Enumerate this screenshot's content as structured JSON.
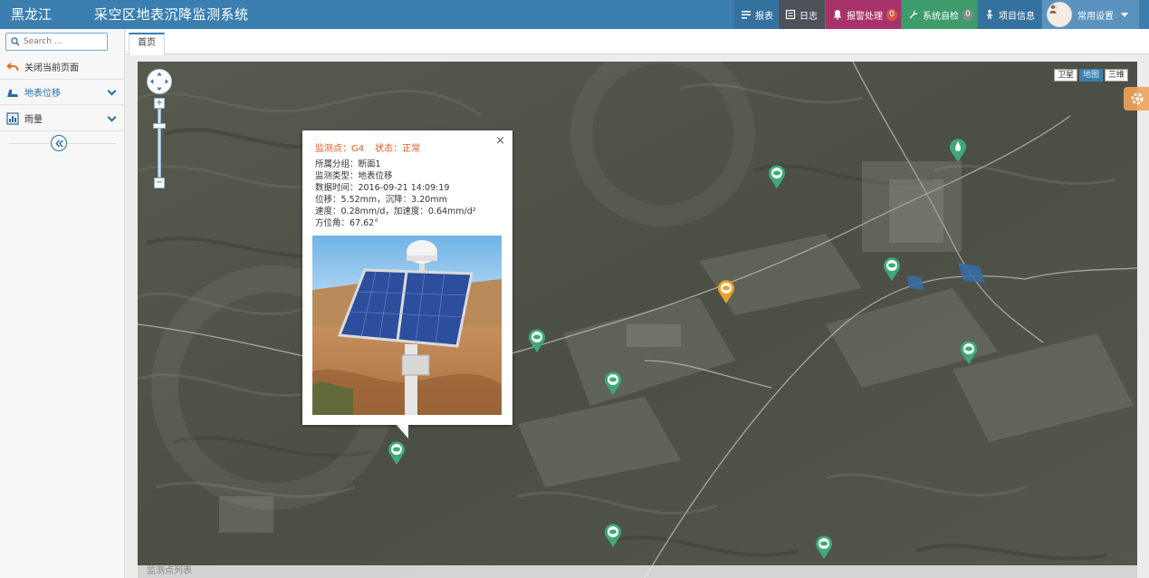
{
  "header": {
    "brand": "黑龙江",
    "title": "采空区地表沉降监测系统",
    "buttons": {
      "report": "报表",
      "log": "日志",
      "alarm": "报警处理",
      "alarm_count": "0",
      "selfcheck": "系统自检",
      "selfcheck_count": "0",
      "project": "项目信息",
      "settings": "常用设置"
    },
    "colors": {
      "bar": "#3a7fb0",
      "alarm": "#a8336a",
      "selfcheck": "#3e9b6c"
    }
  },
  "sidebar": {
    "search_placeholder": "Search ...",
    "items": [
      {
        "label": "关闭当前页面",
        "icon": "undo-icon"
      },
      {
        "label": "地表位移",
        "icon": "displacement-icon"
      },
      {
        "label": "雨量",
        "icon": "rain-gauge-icon"
      }
    ]
  },
  "tabs": [
    {
      "label": "首页"
    }
  ],
  "map": {
    "types": [
      "卫星",
      "地图",
      "三维"
    ],
    "active_type": "地图",
    "bottom_text": "监测点列表"
  },
  "popup": {
    "point_label": "监测点：G4",
    "status_label": "状态：正常",
    "lines": [
      "所属分组：断面1",
      "监测类型：地表位移",
      "数据时间：2016-09-21 14:09:19",
      "位移：5.52mm，沉降：3.20mm",
      "速度：0.28mm/d，加速度：0.64mm/d²",
      "方位角：67.62°"
    ],
    "photo": "solar-panel-gnss-station-photo"
  },
  "markers": {
    "normal_color": "#3daa78",
    "warning_color": "#e8a22a"
  }
}
